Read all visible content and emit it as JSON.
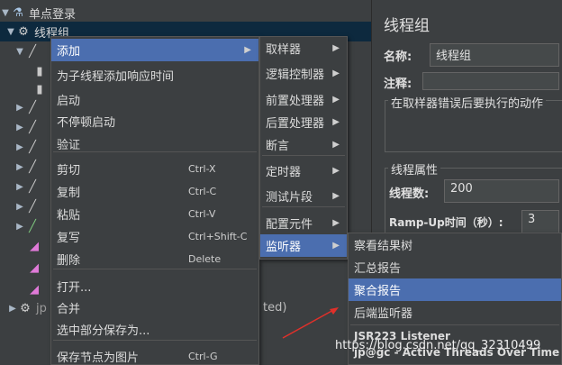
{
  "tree": {
    "root_label": "单点登录",
    "thread_group_label": "线程组"
  },
  "context_menu": {
    "items": [
      {
        "label": "添加",
        "shortcut": "",
        "submenu": true,
        "highlighted": true
      },
      {
        "label": "为子线程添加响应时间",
        "shortcut": "",
        "submenu": false
      },
      {
        "label": "启动",
        "shortcut": "",
        "submenu": false
      },
      {
        "label": "不停顿启动",
        "shortcut": "",
        "submenu": false
      },
      {
        "label": "验证",
        "shortcut": "",
        "submenu": false
      },
      {
        "label": "剪切",
        "shortcut": "Ctrl-X",
        "submenu": false
      },
      {
        "label": "复制",
        "shortcut": "Ctrl-C",
        "submenu": false
      },
      {
        "label": "粘贴",
        "shortcut": "Ctrl-V",
        "submenu": false
      },
      {
        "label": "复写",
        "shortcut": "Ctrl+Shift-C",
        "submenu": false
      },
      {
        "label": "删除",
        "shortcut": "Delete",
        "submenu": false
      },
      {
        "label": "打开...",
        "shortcut": "",
        "submenu": false
      },
      {
        "label": "合并",
        "shortcut": "",
        "submenu": false
      },
      {
        "label": "选中部分保存为...",
        "shortcut": "",
        "submenu": false
      },
      {
        "label": "保存节点为图片",
        "shortcut": "Ctrl-G",
        "submenu": false
      }
    ]
  },
  "add_menu": {
    "items": [
      {
        "label": "取样器"
      },
      {
        "label": "逻辑控制器"
      },
      {
        "label": "前置处理器"
      },
      {
        "label": "后置处理器"
      },
      {
        "label": "断言"
      },
      {
        "label": "定时器"
      },
      {
        "label": "测试片段"
      },
      {
        "label": "配置元件"
      },
      {
        "label": "监听器",
        "highlighted": true
      }
    ]
  },
  "listener_menu": {
    "items": [
      {
        "label": "察看结果树"
      },
      {
        "label": "汇总报告"
      },
      {
        "label": "聚合报告",
        "highlighted": true
      },
      {
        "label": "后端监听器"
      },
      {
        "label": "JSR223 Listener"
      },
      {
        "label": "jp@gc - Active Threads Over Time"
      }
    ]
  },
  "panel": {
    "title": "线程组",
    "name_label": "名称:",
    "name_value": "线程组",
    "comment_label": "注释:",
    "error_group_title": "在取样器错误后要执行的动作",
    "thread_props_title": "线程属性",
    "threads_label": "线程数:",
    "threads_value": "200",
    "rampup_label": "Ramp-Up时间（秒）:",
    "rampup_value": "3"
  },
  "partial_text": "ted)",
  "watermark": "https://blog.csdn.net/qq_32310499",
  "colors": {
    "background": "#3c3f41",
    "highlight": "#4b6eaf",
    "selection": "#0d293e"
  }
}
